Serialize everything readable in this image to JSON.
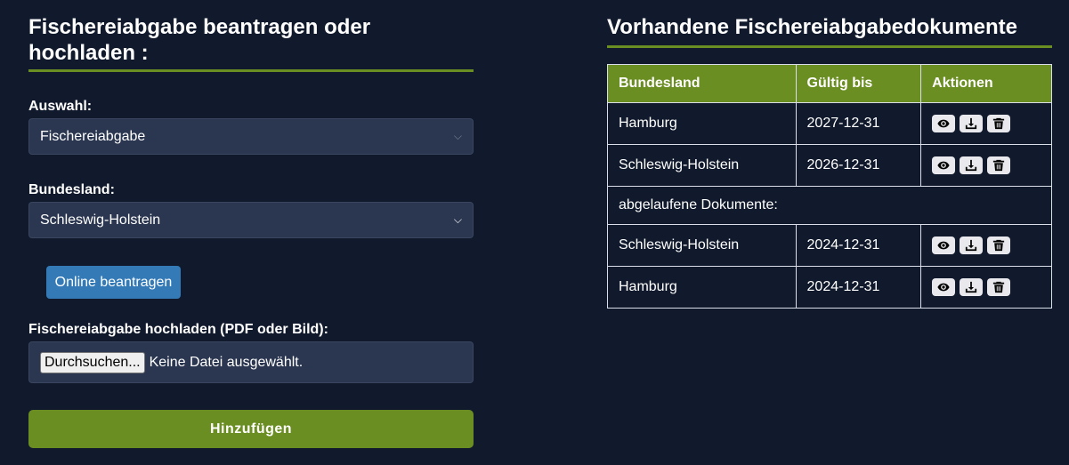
{
  "left": {
    "title": "Fischereiabgabe beantragen oder hochladen :",
    "auswahl_label": "Auswahl:",
    "auswahl_value": "Fischereiabgabe",
    "bundesland_label": "Bundesland:",
    "bundesland_value": "Schleswig-Holstein",
    "online_button": "Online beantragen",
    "upload_label": "Fischereiabgabe hochladen (PDF oder Bild):",
    "file_button": "Durchsuchen...",
    "file_status": "Keine Datei ausgewählt.",
    "add_button": "Hinzufügen"
  },
  "right": {
    "title": "Vorhandene Fischereiabgabedokumente",
    "headers": [
      "Bundesland",
      "Gültig bis",
      "Aktionen"
    ],
    "rows": [
      {
        "bundesland": "Hamburg",
        "gueltig": "2027-12-31"
      },
      {
        "bundesland": "Schleswig-Holstein",
        "gueltig": "2026-12-31"
      }
    ],
    "expired_label": "abgelaufene Dokumente:",
    "expired_rows": [
      {
        "bundesland": "Schleswig-Holstein",
        "gueltig": "2024-12-31"
      },
      {
        "bundesland": "Hamburg",
        "gueltig": "2024-12-31"
      }
    ]
  },
  "colors": {
    "background": "#111a2c",
    "accent_green": "#6b8e23",
    "button_blue": "#337ab7",
    "input_bg": "#2b3750"
  },
  "icons": [
    "eye-icon",
    "download-icon",
    "trash-icon"
  ]
}
